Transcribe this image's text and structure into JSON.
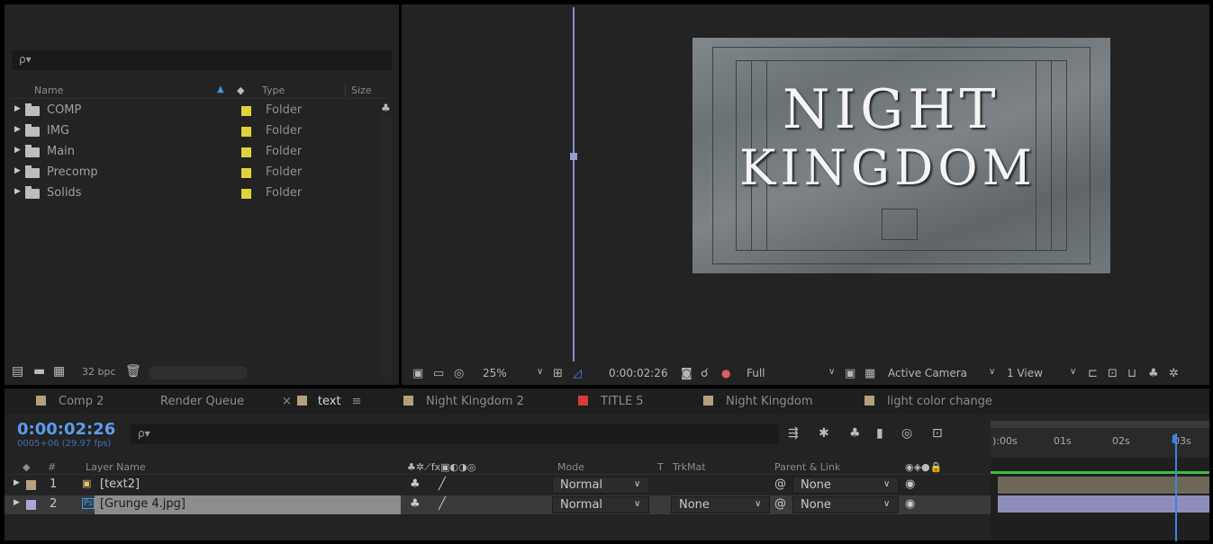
{
  "project": {
    "search_placeholder": "ρ▾",
    "columns": {
      "name": "Name",
      "type": "Type",
      "size": "Size"
    },
    "items": [
      {
        "name": "COMP",
        "type": "Folder",
        "label_color": "#e2d23a"
      },
      {
        "name": "IMG",
        "type": "Folder",
        "label_color": "#e2d23a"
      },
      {
        "name": "Main",
        "type": "Folder",
        "label_color": "#e2d23a"
      },
      {
        "name": "Precomp",
        "type": "Folder",
        "label_color": "#e2d23a"
      },
      {
        "name": "Solids",
        "type": "Folder",
        "label_color": "#e2d23a"
      }
    ],
    "bpc": "32 bpc"
  },
  "viewer": {
    "title_line1": "NIGHT",
    "title_line2": "KINGDOM",
    "zoom": "25%",
    "timecode": "0:00:02:26",
    "resolution": "Full",
    "camera": "Active Camera",
    "view": "1 View"
  },
  "timeline": {
    "tabs": [
      {
        "label": "Comp 2",
        "color": "#b59f7d"
      },
      {
        "label": "Render Queue",
        "color": ""
      },
      {
        "label": "text",
        "color": "#b59f7d",
        "active": true
      },
      {
        "label": "Night Kingdom 2",
        "color": "#b59f7d"
      },
      {
        "label": "TITLE 5",
        "color": "#d63a3a"
      },
      {
        "label": "Night Kingdom",
        "color": "#b59f7d"
      },
      {
        "label": "light color change",
        "color": "#b59f7d"
      }
    ],
    "current_time": "0:00:02:26",
    "fps": "0005+06 (29.97 fps)",
    "search_placeholder": "ρ▾",
    "columns": {
      "num": "#",
      "layer_name": "Layer Name",
      "mode": "Mode",
      "t": "T",
      "trkmat": "TrkMat",
      "parent": "Parent & Link"
    },
    "layers": [
      {
        "num": "1",
        "name": "[text2]",
        "mode": "Normal",
        "trkmat": "",
        "parent": "None",
        "label_color": "#b59f7d"
      },
      {
        "num": "2",
        "name": "[Grunge 4.jpg]",
        "mode": "Normal",
        "trkmat": "None",
        "parent": "None",
        "label_color": "#a9a8d8"
      }
    ],
    "ruler": [
      "):00s",
      "01s",
      "02s",
      "03s"
    ]
  }
}
